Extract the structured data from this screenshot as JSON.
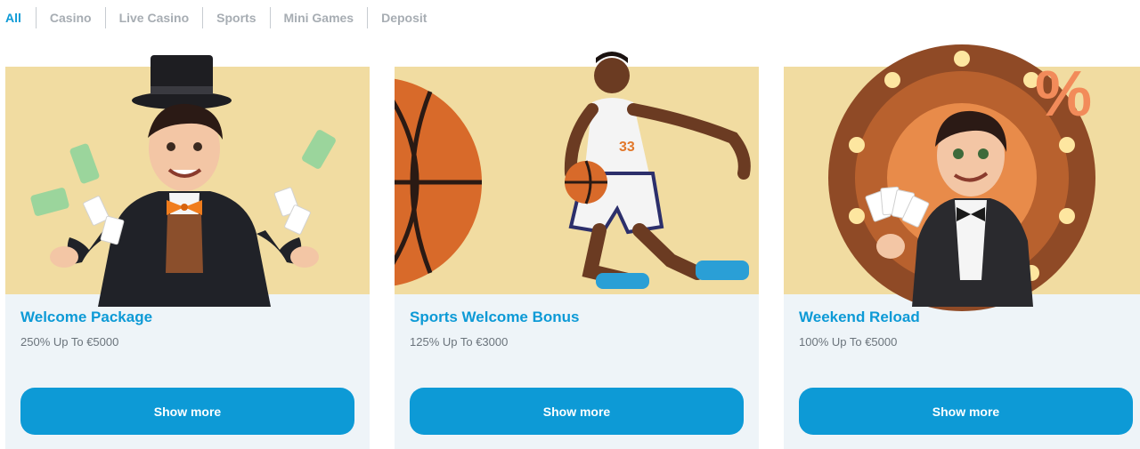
{
  "tabs": [
    {
      "label": "All",
      "active": true
    },
    {
      "label": "Casino",
      "active": false
    },
    {
      "label": "Live Casino",
      "active": false
    },
    {
      "label": "Sports",
      "active": false
    },
    {
      "label": "Mini Games",
      "active": false
    },
    {
      "label": "Deposit",
      "active": false
    }
  ],
  "cards": [
    {
      "title": "Welcome Package",
      "subtitle": "250% Up To €5000",
      "button": "Show more",
      "image": "magician-illustration"
    },
    {
      "title": "Sports Welcome Bonus",
      "subtitle": "125% Up To €3000",
      "button": "Show more",
      "image": "basketball-player-illustration",
      "jersey_number": "33"
    },
    {
      "title": "Weekend Reload",
      "subtitle": "100% Up To €5000",
      "button": "Show more",
      "image": "casino-dealer-illustration",
      "percent_symbol": "%"
    }
  ],
  "colors": {
    "accent": "#0d9ad6",
    "tab_inactive": "#a7adb3",
    "hero_background": "#f1dca1",
    "card_background": "#eef4f8"
  }
}
